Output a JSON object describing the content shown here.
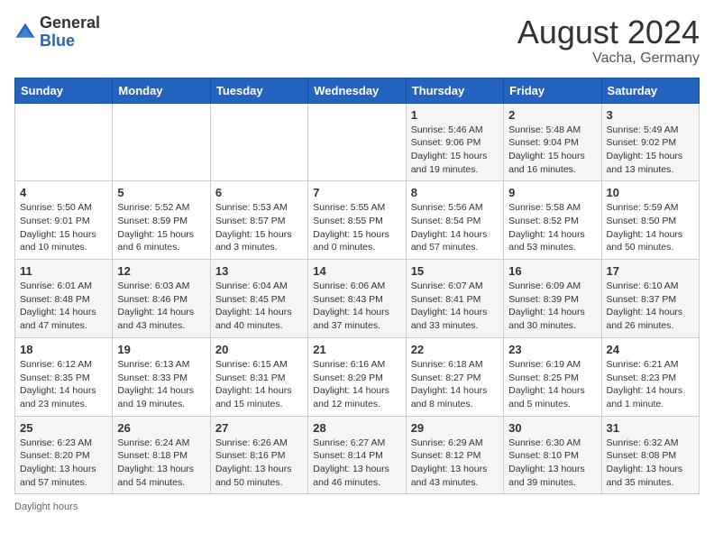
{
  "header": {
    "logo_general": "General",
    "logo_blue": "Blue",
    "month_year": "August 2024",
    "location": "Vacha, Germany"
  },
  "days_of_week": [
    "Sunday",
    "Monday",
    "Tuesday",
    "Wednesday",
    "Thursday",
    "Friday",
    "Saturday"
  ],
  "weeks": [
    [
      {
        "day": "",
        "info": ""
      },
      {
        "day": "",
        "info": ""
      },
      {
        "day": "",
        "info": ""
      },
      {
        "day": "",
        "info": ""
      },
      {
        "day": "1",
        "info": "Sunrise: 5:46 AM\nSunset: 9:06 PM\nDaylight: 15 hours\nand 19 minutes."
      },
      {
        "day": "2",
        "info": "Sunrise: 5:48 AM\nSunset: 9:04 PM\nDaylight: 15 hours\nand 16 minutes."
      },
      {
        "day": "3",
        "info": "Sunrise: 5:49 AM\nSunset: 9:02 PM\nDaylight: 15 hours\nand 13 minutes."
      }
    ],
    [
      {
        "day": "4",
        "info": "Sunrise: 5:50 AM\nSunset: 9:01 PM\nDaylight: 15 hours\nand 10 minutes."
      },
      {
        "day": "5",
        "info": "Sunrise: 5:52 AM\nSunset: 8:59 PM\nDaylight: 15 hours\nand 6 minutes."
      },
      {
        "day": "6",
        "info": "Sunrise: 5:53 AM\nSunset: 8:57 PM\nDaylight: 15 hours\nand 3 minutes."
      },
      {
        "day": "7",
        "info": "Sunrise: 5:55 AM\nSunset: 8:55 PM\nDaylight: 15 hours\nand 0 minutes."
      },
      {
        "day": "8",
        "info": "Sunrise: 5:56 AM\nSunset: 8:54 PM\nDaylight: 14 hours\nand 57 minutes."
      },
      {
        "day": "9",
        "info": "Sunrise: 5:58 AM\nSunset: 8:52 PM\nDaylight: 14 hours\nand 53 minutes."
      },
      {
        "day": "10",
        "info": "Sunrise: 5:59 AM\nSunset: 8:50 PM\nDaylight: 14 hours\nand 50 minutes."
      }
    ],
    [
      {
        "day": "11",
        "info": "Sunrise: 6:01 AM\nSunset: 8:48 PM\nDaylight: 14 hours\nand 47 minutes."
      },
      {
        "day": "12",
        "info": "Sunrise: 6:03 AM\nSunset: 8:46 PM\nDaylight: 14 hours\nand 43 minutes."
      },
      {
        "day": "13",
        "info": "Sunrise: 6:04 AM\nSunset: 8:45 PM\nDaylight: 14 hours\nand 40 minutes."
      },
      {
        "day": "14",
        "info": "Sunrise: 6:06 AM\nSunset: 8:43 PM\nDaylight: 14 hours\nand 37 minutes."
      },
      {
        "day": "15",
        "info": "Sunrise: 6:07 AM\nSunset: 8:41 PM\nDaylight: 14 hours\nand 33 minutes."
      },
      {
        "day": "16",
        "info": "Sunrise: 6:09 AM\nSunset: 8:39 PM\nDaylight: 14 hours\nand 30 minutes."
      },
      {
        "day": "17",
        "info": "Sunrise: 6:10 AM\nSunset: 8:37 PM\nDaylight: 14 hours\nand 26 minutes."
      }
    ],
    [
      {
        "day": "18",
        "info": "Sunrise: 6:12 AM\nSunset: 8:35 PM\nDaylight: 14 hours\nand 23 minutes."
      },
      {
        "day": "19",
        "info": "Sunrise: 6:13 AM\nSunset: 8:33 PM\nDaylight: 14 hours\nand 19 minutes."
      },
      {
        "day": "20",
        "info": "Sunrise: 6:15 AM\nSunset: 8:31 PM\nDaylight: 14 hours\nand 15 minutes."
      },
      {
        "day": "21",
        "info": "Sunrise: 6:16 AM\nSunset: 8:29 PM\nDaylight: 14 hours\nand 12 minutes."
      },
      {
        "day": "22",
        "info": "Sunrise: 6:18 AM\nSunset: 8:27 PM\nDaylight: 14 hours\nand 8 minutes."
      },
      {
        "day": "23",
        "info": "Sunrise: 6:19 AM\nSunset: 8:25 PM\nDaylight: 14 hours\nand 5 minutes."
      },
      {
        "day": "24",
        "info": "Sunrise: 6:21 AM\nSunset: 8:23 PM\nDaylight: 14 hours\nand 1 minute."
      }
    ],
    [
      {
        "day": "25",
        "info": "Sunrise: 6:23 AM\nSunset: 8:20 PM\nDaylight: 13 hours\nand 57 minutes."
      },
      {
        "day": "26",
        "info": "Sunrise: 6:24 AM\nSunset: 8:18 PM\nDaylight: 13 hours\nand 54 minutes."
      },
      {
        "day": "27",
        "info": "Sunrise: 6:26 AM\nSunset: 8:16 PM\nDaylight: 13 hours\nand 50 minutes."
      },
      {
        "day": "28",
        "info": "Sunrise: 6:27 AM\nSunset: 8:14 PM\nDaylight: 13 hours\nand 46 minutes."
      },
      {
        "day": "29",
        "info": "Sunrise: 6:29 AM\nSunset: 8:12 PM\nDaylight: 13 hours\nand 43 minutes."
      },
      {
        "day": "30",
        "info": "Sunrise: 6:30 AM\nSunset: 8:10 PM\nDaylight: 13 hours\nand 39 minutes."
      },
      {
        "day": "31",
        "info": "Sunrise: 6:32 AM\nSunset: 8:08 PM\nDaylight: 13 hours\nand 35 minutes."
      }
    ]
  ],
  "footer": {
    "label": "Daylight hours"
  }
}
